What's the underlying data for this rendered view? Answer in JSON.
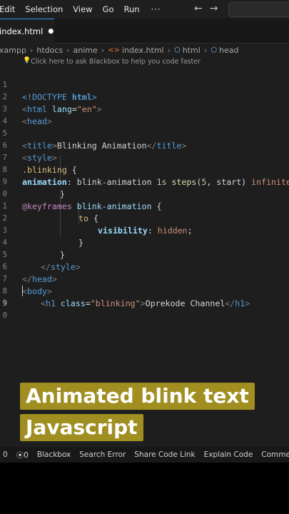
{
  "menubar": {
    "items": [
      "Edit",
      "Selection",
      "View",
      "Go",
      "Run"
    ],
    "more": "···",
    "back_icon": "arrow-left-icon",
    "forward_icon": "arrow-right-icon"
  },
  "tab": {
    "label": "index.html",
    "dirty_dot": "●"
  },
  "breadcrumb": {
    "items": [
      "xampp",
      "htdocs",
      "anime",
      "index.html",
      "html",
      "head"
    ]
  },
  "hint": {
    "text": "Click here to ask Blackbox to help you code faster"
  },
  "line_numbers": [
    "1",
    "2",
    "3",
    "4",
    "5",
    "6",
    "7",
    "8",
    "9",
    "0",
    "1",
    "2",
    "3",
    "4",
    "5",
    "6",
    "7",
    "8",
    "9",
    "0"
  ],
  "code": {
    "l1": [
      "<!DOCTYPE ",
      "html",
      ">"
    ],
    "l2": [
      "<",
      "html",
      " lang",
      "=",
      "\"en\"",
      ">"
    ],
    "l3": [
      "<",
      "head",
      ">"
    ],
    "l5": [
      "<",
      "title",
      ">",
      "Blinking Animation",
      "</",
      "title",
      ">"
    ],
    "l6": [
      "<",
      "style",
      ">"
    ],
    "l7": [
      ".blinking",
      " {"
    ],
    "l8": [
      "animation",
      ": ",
      "blink-animation",
      " ",
      "1s",
      " ",
      "steps",
      "(",
      "5",
      ", start) ",
      "infinite",
      ";"
    ],
    "l9": [
      "}"
    ],
    "l10": [
      "@keyframes",
      " ",
      "blink-animation",
      " {"
    ],
    "l11": [
      "to",
      " {"
    ],
    "l12": [
      "visibility",
      ": ",
      "hidden",
      ";"
    ],
    "l13": [
      "}"
    ],
    "l14": [
      "}"
    ],
    "l15": [
      "</",
      "style",
      ">"
    ],
    "l16": [
      "</",
      "head",
      ">"
    ],
    "l17": [
      "<",
      "body",
      ">"
    ],
    "l18": [
      "<",
      "h1",
      " class",
      "=",
      "\"blinking\"",
      ">",
      "Oprekode Channel",
      "</",
      "h1",
      ">"
    ]
  },
  "caption": {
    "line1": "Animated blink text",
    "line2": "Javascript"
  },
  "statusbar": {
    "errors": "0",
    "warnings": "0",
    "items": [
      "Blackbox",
      "Search Error",
      "Share Code Link",
      "Explain Code",
      "Comment Code"
    ]
  }
}
